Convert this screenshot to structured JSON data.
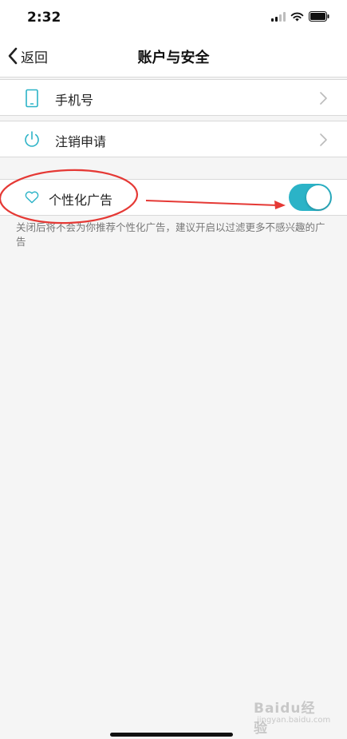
{
  "status_bar": {
    "time": "2:32"
  },
  "nav": {
    "back_label": "返回",
    "title": "账户与安全"
  },
  "rows": [
    {
      "label": "手机号",
      "icon": "phone-icon"
    },
    {
      "label": "注销申请",
      "icon": "power-icon"
    }
  ],
  "personalized_ads": {
    "label": "个性化广告",
    "icon": "heart-icon",
    "enabled": true,
    "hint": "关闭后将不会为你推荐个性化广告，建议开启以过滤更多不感兴趣的广告"
  },
  "watermark": {
    "text": "Baidu经验",
    "sub": "jingyan.baidu.com"
  },
  "colors": {
    "accent": "#2bb3c7",
    "annotation": "#e53935",
    "background": "#f5f5f5"
  }
}
